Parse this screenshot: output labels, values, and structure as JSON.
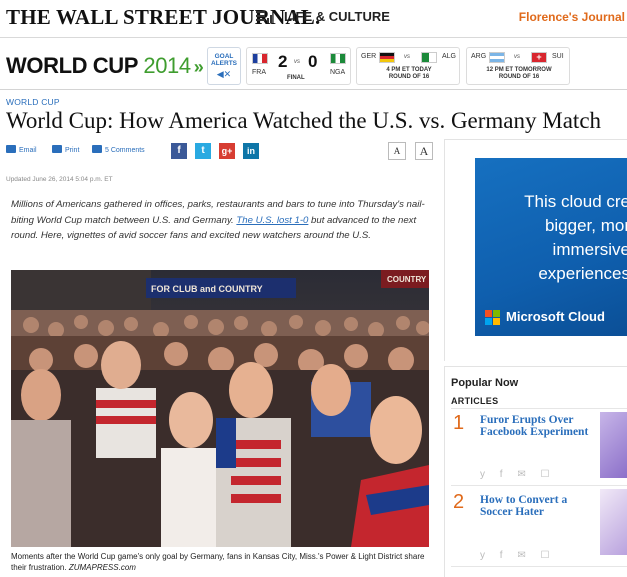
{
  "masthead": {
    "logo": "THE WALL STREET JOURNAL.",
    "section": "LIFE & CULTURE",
    "user_link": "Florence's Journal"
  },
  "worldcup": {
    "title_main": "WORLD CUP",
    "title_year": "2014",
    "title_chevron": "»",
    "goal_alerts": "GOAL ALERTS",
    "speaker_icon": "speaker-off-icon",
    "match_main": {
      "home": "FRA",
      "away": "NGA",
      "home_score": "2",
      "away_score": "0",
      "vs": "vs",
      "status": "FINAL"
    },
    "match_2": {
      "home": "GER",
      "away": "ALG",
      "vs": "vs",
      "status_line1": "4 PM ET TODAY",
      "status_line2": "ROUND OF 16"
    },
    "match_3": {
      "home": "ARG",
      "away": "SUI",
      "vs": "vs",
      "status_line1": "12 PM ET TOMORROW",
      "status_line2": "ROUND OF 16"
    }
  },
  "article": {
    "kicker": "WORLD CUP",
    "headline": "World Cup: How America Watched the U.S. vs. Germany Match",
    "tools": {
      "email": "Email",
      "print": "Print",
      "comments": "5 Comments"
    },
    "social": {
      "facebook": "f",
      "twitter": "t",
      "googleplus": "g+",
      "linkedin": "in"
    },
    "font_small": "A",
    "font_large": "A",
    "updated": "Updated June 26, 2014 5:04 p.m. ET",
    "dek_part1": "Millions of Americans gathered in offices, parks, restaurants and bars to tune into Thursday's nail-biting World Cup match between U.S. and Germany. ",
    "dek_link": "The U.S. lost 1-0",
    "dek_part2": " but advanced to the next round. Here, vignettes of avid soccer fans and excited new watchers around the U.S.",
    "photo_sign": "FOR CLUB and COUNTRY",
    "photo_sign_right": "COUNTRY",
    "caption": "Moments after the World Cup game's only goal by Germany, fans in Kansas City, Miss.'s Power & Light District share their frustration.",
    "caption_credit": "ZUMAPRESS.com"
  },
  "ad": {
    "line1": "This cloud cre",
    "line2": "bigger, mor",
    "line3": "immersive",
    "line4": "experiences",
    "brand": "Microsoft Cloud"
  },
  "popular": {
    "title": "Popular Now",
    "tab": "ARTICLES",
    "items": [
      {
        "num": "1",
        "title": "Furor Erupts Over Facebook Experiment"
      },
      {
        "num": "2",
        "title": "How to Convert a Soccer Hater"
      }
    ],
    "share_icons": "y f ✉ ☐"
  },
  "colors": {
    "accent_orange": "#e06a1b",
    "link_blue": "#2a6ebb",
    "worldcup_green": "#3f9d2f"
  }
}
